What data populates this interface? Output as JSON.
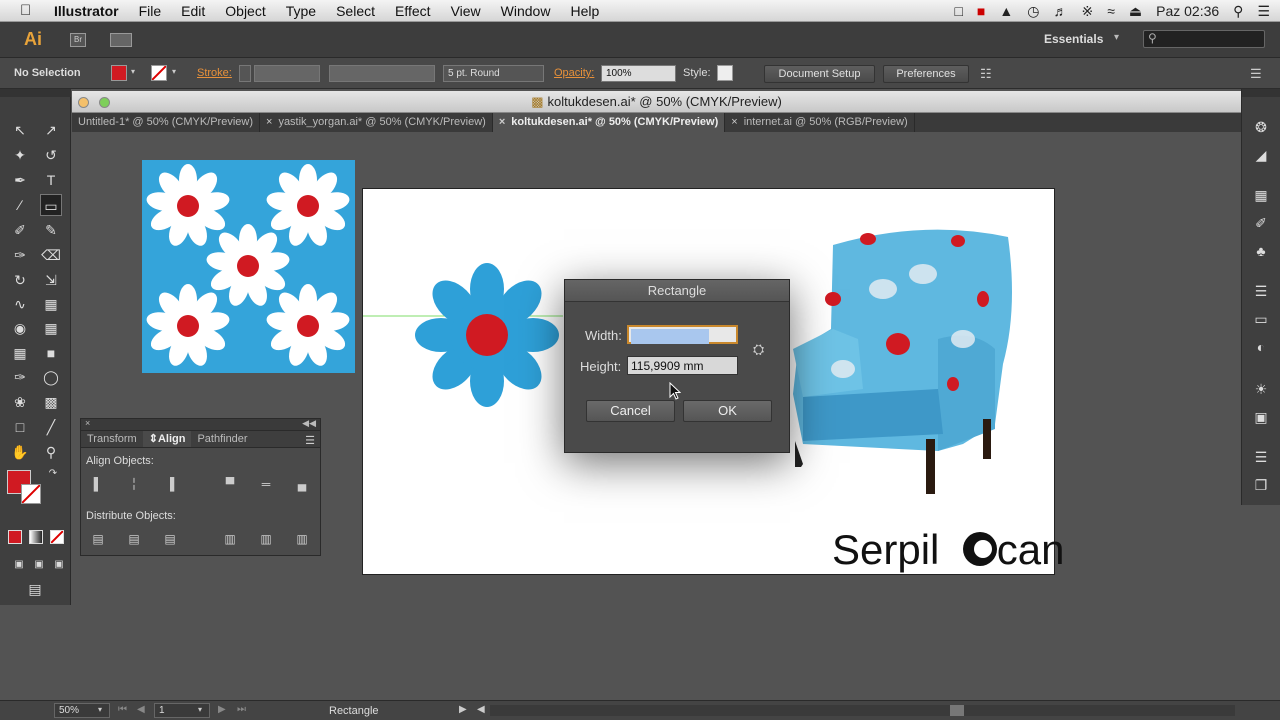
{
  "menubar": {
    "items": [
      "Illustrator",
      "File",
      "Edit",
      "Object",
      "Type",
      "Select",
      "Effect",
      "View",
      "Window",
      "Help"
    ],
    "clock": "Paz 02:36"
  },
  "appbar": {
    "logo": "Ai",
    "bridge": "Br",
    "workspace": "Essentials"
  },
  "control": {
    "selection": "No Selection",
    "stroke_label": "Stroke:",
    "brush": "5 pt. Round",
    "opacity_label": "Opacity:",
    "opacity": "100%",
    "style_label": "Style:",
    "document_setup": "Document Setup",
    "preferences": "Preferences",
    "fill_color": "#d01a22"
  },
  "window": {
    "title": "koltukdesen.ai* @ 50% (CMYK/Preview)"
  },
  "tabs": [
    {
      "label": "Untitled-1* @ 50% (CMYK/Preview)"
    },
    {
      "label": "yastik_yorgan.ai* @ 50% (CMYK/Preview)"
    },
    {
      "label": "koltukdesen.ai* @ 50% (CMYK/Preview)"
    },
    {
      "label": "internet.ai @ 50% (RGB/Preview)"
    }
  ],
  "align_panel": {
    "tabs": [
      "Transform",
      "Align",
      "Pathfinder"
    ],
    "align_objects": "Align Objects:",
    "distribute_objects": "Distribute Objects:"
  },
  "dialog": {
    "title": "Rectangle",
    "width_label": "Width:",
    "width_value": "33,8667 mm",
    "height_label": "Height:",
    "height_value": "115,9909 mm",
    "cancel": "Cancel",
    "ok": "OK"
  },
  "artwork": {
    "signature_1": "Serpil",
    "signature_2": "can",
    "flower_blue": "#2ea0d8",
    "flower_center": "#d01a22",
    "pattern_bg": "#34a4da"
  },
  "status": {
    "zoom": "50%",
    "artboard": "1",
    "current_tool": "Rectangle"
  }
}
